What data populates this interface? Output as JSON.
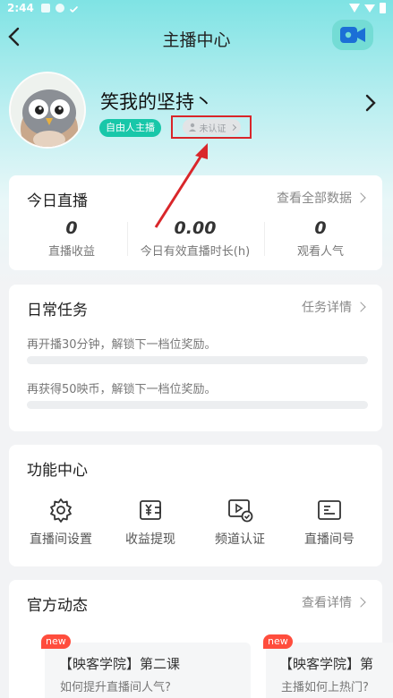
{
  "status_bar": {
    "time": "2:44"
  },
  "header": {
    "title": "主播中心",
    "back_icon": "chevron-left-icon",
    "video_icon": "video-camera-icon"
  },
  "profile": {
    "name": "笑我的坚持丶",
    "badge": "自由人主播",
    "verify_status": "未认证",
    "colors": {
      "badge": "#18c7a9",
      "highlight_box": "#d9262a"
    }
  },
  "today_live": {
    "title": "今日直播",
    "link": "查看全部数据",
    "stats": [
      {
        "value": "0",
        "label": "直播收益"
      },
      {
        "value": "0.00",
        "label": "今日有效直播时长(h)"
      },
      {
        "value": "0",
        "label": "观看人气"
      }
    ]
  },
  "daily_tasks": {
    "title": "日常任务",
    "link": "任务详情",
    "tasks": [
      {
        "text": "再开播30分钟，解锁下一档位奖励。",
        "progress": 0
      },
      {
        "text": "再获得50映币，解锁下一档位奖励。",
        "progress": 0
      }
    ]
  },
  "functions": {
    "title": "功能中心",
    "items": [
      {
        "label": "直播间设置",
        "icon": "gear-icon"
      },
      {
        "label": "收益提现",
        "icon": "yuan-wallet-icon"
      },
      {
        "label": "频道认证",
        "icon": "video-verified-icon"
      },
      {
        "label": "直播间号",
        "icon": "id-card-icon"
      }
    ]
  },
  "official_news": {
    "title": "官方动态",
    "link": "查看详情",
    "items": [
      {
        "tag": "new",
        "title": "【映客学院】第二课",
        "subtitle": "如何提升直播间人气?"
      },
      {
        "tag": "new",
        "title": "【映客学院】第",
        "subtitle": "主播如何上热门?"
      }
    ]
  }
}
